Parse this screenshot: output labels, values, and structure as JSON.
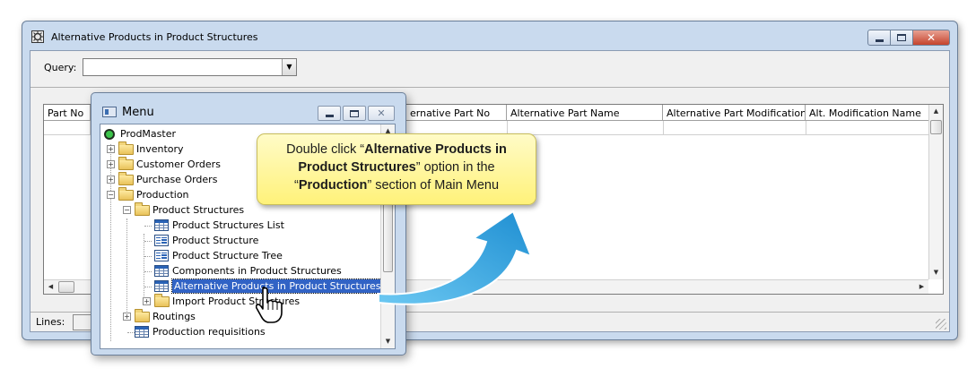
{
  "main_window": {
    "title": "Alternative Products in Product Structures",
    "query_label": "Query:",
    "query_value": "",
    "columns": [
      "Part No",
      "Alternative Part No",
      "Alternative Part Name",
      "Alternative Part Modification",
      "Alt. Modification Name"
    ],
    "column_partial_visible": "ernative Part No",
    "status_lines_label": "Lines:"
  },
  "menu_window": {
    "title": "Menu",
    "tree": {
      "root": "ProdMaster",
      "inventory": "Inventory",
      "customer_orders": "Customer Orders",
      "purchase_orders": "Purchase Orders",
      "production": "Production",
      "product_structures": "Product Structures",
      "product_structures_list": "Product Structures List",
      "product_structure": "Product Structure",
      "product_structure_tree": "Product Structure Tree",
      "components": "Components in Product Structures",
      "alternative_products": "Alternative Products in Product Structures",
      "import_product_structures": "Import Product Structures",
      "routings": "Routings",
      "production_requisitions": "Production requisitions"
    }
  },
  "callout": {
    "prefix": "Double click “",
    "bold1": "Alternative Products in Product Structures",
    "middle": "” option in the “",
    "bold2": "Production",
    "suffix": "” section of Main Menu"
  },
  "colors": {
    "callout_bg": "#fff27a",
    "selection": "#3163c5",
    "arrow": "#2a9fdc"
  }
}
